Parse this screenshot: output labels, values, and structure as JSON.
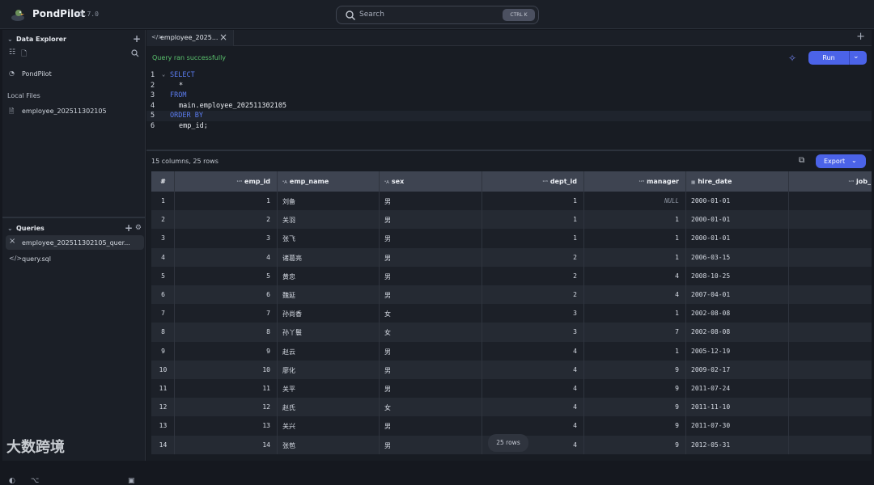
{
  "topbar": {
    "brand": "PondPilot",
    "version": "v0.7.0",
    "search_label": "Search",
    "search_shortcut": "CTRL K"
  },
  "sidebar": {
    "data_explorer_title": "Data Explorer",
    "database_name": "PondPilot",
    "local_files_label": "Local Files",
    "files": [
      "employee_202511302105"
    ],
    "queries_title": "Queries",
    "queries": [
      {
        "label": "employee_202511302105_quer...",
        "icon": "close-icon",
        "active": true
      },
      {
        "label": "query.sql",
        "icon": "code-icon",
        "active": false
      }
    ]
  },
  "editor": {
    "tab_label": "employee_2025...",
    "status": "Query ran successfully",
    "run_label": "Run",
    "lines": [
      {
        "n": "1",
        "kw": "SELECT",
        "txt": ""
      },
      {
        "n": "2",
        "kw": "",
        "txt": "*"
      },
      {
        "n": "3",
        "kw": "FROM",
        "txt": ""
      },
      {
        "n": "4",
        "kw": "",
        "txt": "main.employee_202511302105"
      },
      {
        "n": "5",
        "kw": "ORDER BY",
        "txt": ""
      },
      {
        "n": "6",
        "kw": "",
        "txt": "emp_id;"
      }
    ]
  },
  "results": {
    "info": "15 columns, 25 rows",
    "export_label": "Export",
    "row_count_badge": "25 rows",
    "columns": [
      {
        "name": "#",
        "type": ""
      },
      {
        "name": "emp_id",
        "type": "123"
      },
      {
        "name": "emp_name",
        "type": "aA"
      },
      {
        "name": "sex",
        "type": "aA"
      },
      {
        "name": "dept_id",
        "type": "123"
      },
      {
        "name": "manager",
        "type": "123"
      },
      {
        "name": "hire_date",
        "type": "date"
      },
      {
        "name": "job_",
        "type": "123"
      }
    ],
    "rows": [
      [
        "1",
        "1",
        "刘备",
        "男",
        "1",
        "NULL",
        "2000-01-01"
      ],
      [
        "2",
        "2",
        "关羽",
        "男",
        "1",
        "1",
        "2000-01-01"
      ],
      [
        "3",
        "3",
        "张飞",
        "男",
        "1",
        "1",
        "2000-01-01"
      ],
      [
        "4",
        "4",
        "诸葛亮",
        "男",
        "2",
        "1",
        "2006-03-15"
      ],
      [
        "5",
        "5",
        "黄忠",
        "男",
        "2",
        "4",
        "2008-10-25"
      ],
      [
        "6",
        "6",
        "魏延",
        "男",
        "2",
        "4",
        "2007-04-01"
      ],
      [
        "7",
        "7",
        "孙尚香",
        "女",
        "3",
        "1",
        "2002-08-08"
      ],
      [
        "8",
        "8",
        "孙丫鬟",
        "女",
        "3",
        "7",
        "2002-08-08"
      ],
      [
        "9",
        "9",
        "赵云",
        "男",
        "4",
        "1",
        "2005-12-19"
      ],
      [
        "10",
        "10",
        "廖化",
        "男",
        "4",
        "9",
        "2009-02-17"
      ],
      [
        "11",
        "11",
        "关平",
        "男",
        "4",
        "9",
        "2011-07-24"
      ],
      [
        "12",
        "12",
        "赵氏",
        "女",
        "4",
        "9",
        "2011-11-10"
      ],
      [
        "13",
        "13",
        "关兴",
        "男",
        "4",
        "9",
        "2011-07-30"
      ],
      [
        "14",
        "14",
        "张苞",
        "男",
        "4",
        "9",
        "2012-05-31"
      ]
    ]
  },
  "watermark": "大数跨境",
  "colors": {
    "accent": "#4b63e8",
    "success": "#5bc46e",
    "keyword": "#5b7cf0",
    "header_bg": "#3e4451"
  }
}
